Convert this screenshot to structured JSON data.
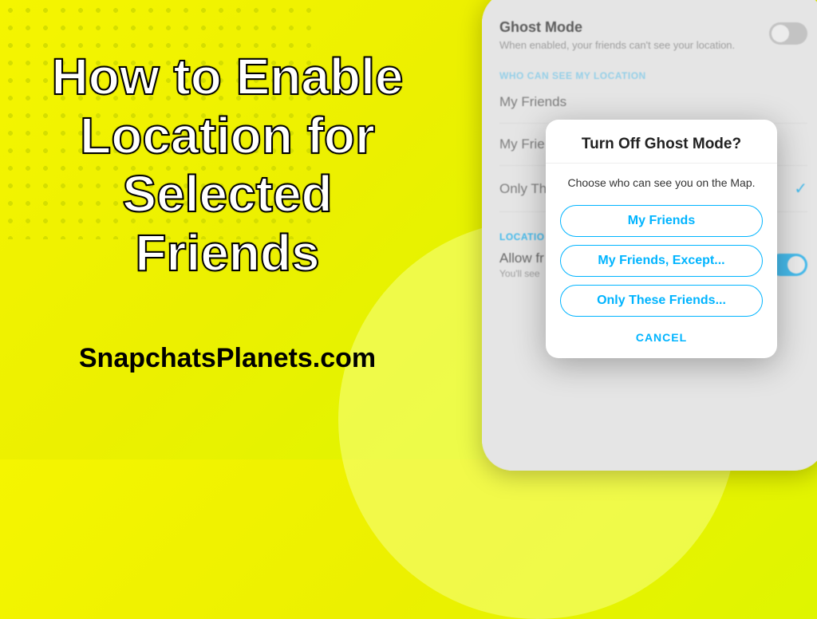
{
  "banner": {
    "headline": "How to Enable Location for Selected Friends",
    "site": "SnapchatsPlanets.com"
  },
  "settings": {
    "ghost": {
      "title": "Ghost Mode",
      "description": "When enabled, your friends can't see your location."
    },
    "section_visibility_label": "WHO CAN SEE MY LOCATION",
    "options": [
      {
        "label": "My Friends"
      },
      {
        "label": "My Frie"
      },
      {
        "label": "Only Th"
      }
    ],
    "section_requests_label": "LOCATIO",
    "allow_row": {
      "title": "Allow fr",
      "desc": "You'll see"
    }
  },
  "modal": {
    "title": "Turn Off Ghost Mode?",
    "subtitle": "Choose who can see you on the Map.",
    "buttons": [
      "My Friends",
      "My Friends, Except...",
      "Only These Friends..."
    ],
    "cancel": "CANCEL"
  }
}
